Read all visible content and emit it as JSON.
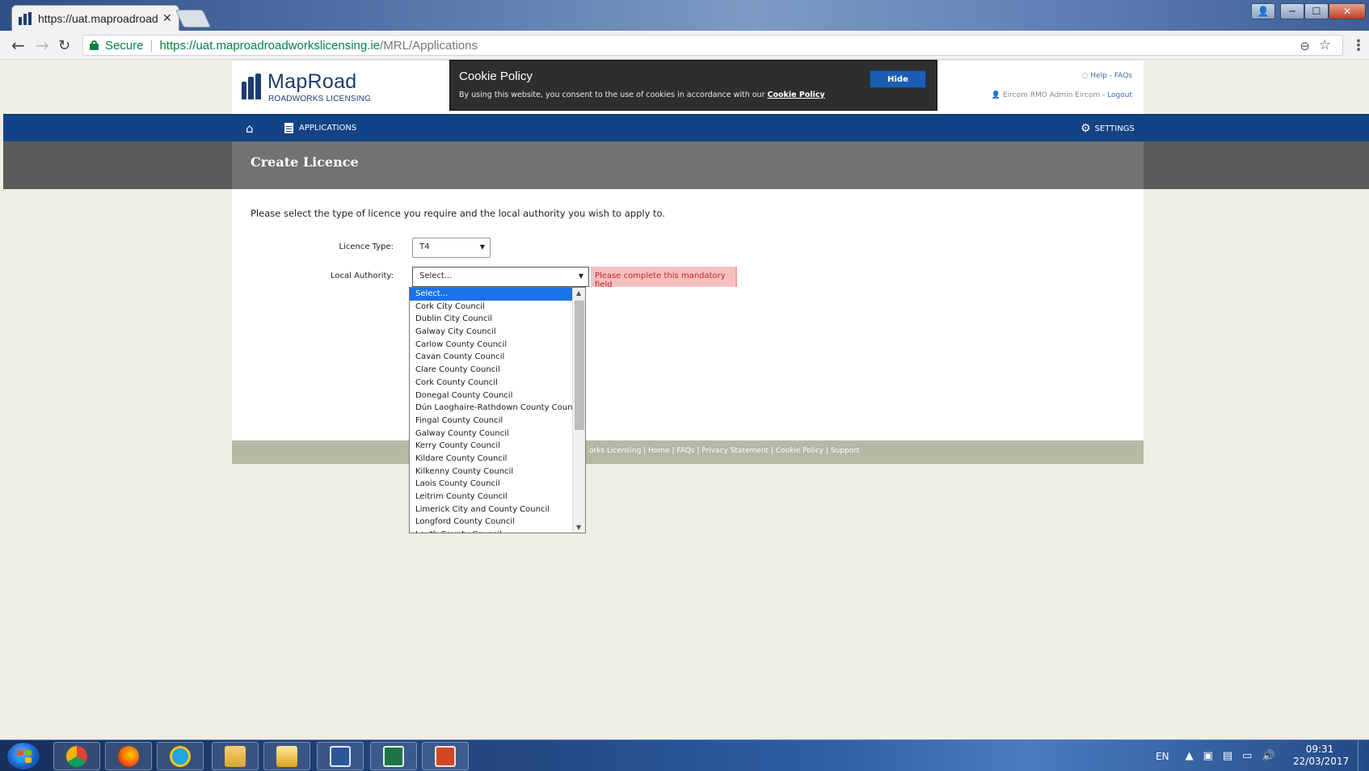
{
  "browser": {
    "tab_title": "https://uat.maproadroad",
    "tab_close": "✕",
    "secure_label": "Secure",
    "separator": "|",
    "url_host": "https://uat.maproadroadworkslicensing.ie",
    "url_path": "/MRL/Applications"
  },
  "header": {
    "logo_name": "MapRoad",
    "logo_sub": "ROADWORKS LICENSING",
    "cookie": {
      "title": "Cookie Policy",
      "text": "By using this website, you consent to the use of cookies in accordance with our ",
      "link": "Cookie Policy",
      "hide_label": "Hide"
    },
    "help_links": "Help - FAQs",
    "user_name": "Eircom RMO Admin Eircom",
    "logout": "Logout"
  },
  "nav": {
    "applications": "APPLICATIONS",
    "settings": "SETTINGS"
  },
  "page": {
    "title": "Create Licence",
    "instructions": "Please select the type of licence you require and the local authority you wish to apply to."
  },
  "form": {
    "licence_type_label": "Licence Type:",
    "licence_type_value": "T4",
    "local_authority_label": "Local Authority:",
    "local_authority_value": "Select...",
    "mandatory_message": "Please complete this mandatory field"
  },
  "dropdown": {
    "options": [
      "Select...",
      "Cork City Council",
      "Dublin City Council",
      "Galway City Council",
      "Carlow County Council",
      "Cavan County Council",
      "Clare County Council",
      "Cork County Council",
      "Donegal County Council",
      "Dún Laoghaire-Rathdown County Council",
      "Fingal County Council",
      "Galway County Council",
      "Kerry County Council",
      "Kildare County Council",
      "Kilkenny County Council",
      "Laois County Council",
      "Leitrim County Council",
      "Limerick City and County Council",
      "Longford County Council",
      "Louth County Council"
    ],
    "selected_index": 0
  },
  "footer": {
    "links": "orks Licensing  | Home | FAQs | Privacy Statement | Cookie Policy | Support"
  },
  "taskbar": {
    "language": "EN",
    "time": "09:31",
    "date": "22/03/2017"
  }
}
